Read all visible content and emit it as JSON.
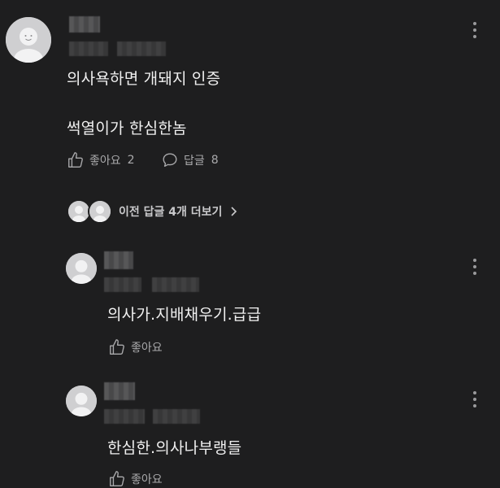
{
  "comment": {
    "text_line1": "의사욕하면 개돼지 인증",
    "text_line2": "썩열이가 한심한놈",
    "like_label": "좋아요",
    "like_count": "2",
    "reply_label": "답글",
    "reply_count": "8"
  },
  "replies_toggle": {
    "label": "이전 답글 4개 더보기"
  },
  "replies": [
    {
      "text": "의사가.지배채우기.급급",
      "like_label": "좋아요"
    },
    {
      "text": "한심한.의사나부랭들",
      "like_label": "좋아요"
    }
  ],
  "colors": {
    "background": "#1e1e1f",
    "text": "#f0f0f0",
    "muted": "#a9a9ab",
    "avatar": "#cfcfd1"
  }
}
